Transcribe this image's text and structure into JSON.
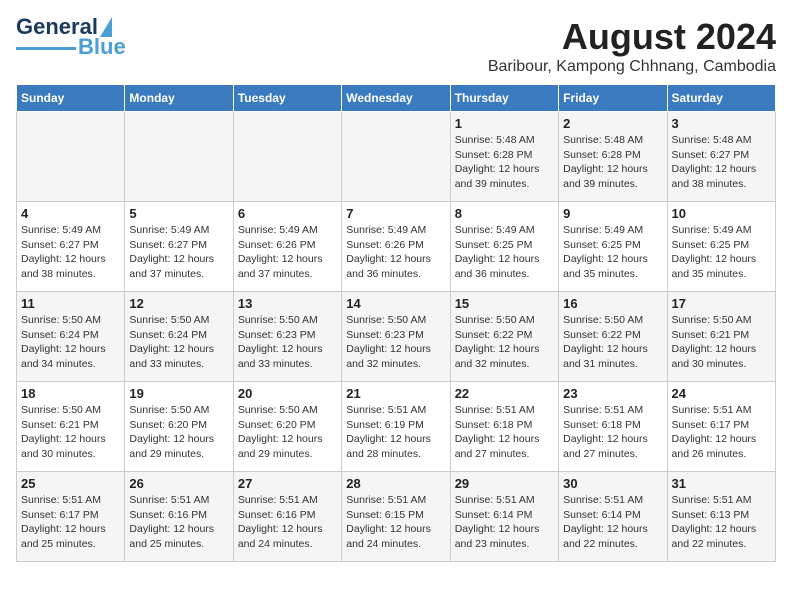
{
  "logo": {
    "text1": "General",
    "text2": "Blue"
  },
  "title": {
    "month_year": "August 2024",
    "location": "Baribour, Kampong Chhnang, Cambodia"
  },
  "headers": [
    "Sunday",
    "Monday",
    "Tuesday",
    "Wednesday",
    "Thursday",
    "Friday",
    "Saturday"
  ],
  "weeks": [
    [
      {
        "day": "",
        "info": ""
      },
      {
        "day": "",
        "info": ""
      },
      {
        "day": "",
        "info": ""
      },
      {
        "day": "",
        "info": ""
      },
      {
        "day": "1",
        "info": "Sunrise: 5:48 AM\nSunset: 6:28 PM\nDaylight: 12 hours\nand 39 minutes."
      },
      {
        "day": "2",
        "info": "Sunrise: 5:48 AM\nSunset: 6:28 PM\nDaylight: 12 hours\nand 39 minutes."
      },
      {
        "day": "3",
        "info": "Sunrise: 5:48 AM\nSunset: 6:27 PM\nDaylight: 12 hours\nand 38 minutes."
      }
    ],
    [
      {
        "day": "4",
        "info": "Sunrise: 5:49 AM\nSunset: 6:27 PM\nDaylight: 12 hours\nand 38 minutes."
      },
      {
        "day": "5",
        "info": "Sunrise: 5:49 AM\nSunset: 6:27 PM\nDaylight: 12 hours\nand 37 minutes."
      },
      {
        "day": "6",
        "info": "Sunrise: 5:49 AM\nSunset: 6:26 PM\nDaylight: 12 hours\nand 37 minutes."
      },
      {
        "day": "7",
        "info": "Sunrise: 5:49 AM\nSunset: 6:26 PM\nDaylight: 12 hours\nand 36 minutes."
      },
      {
        "day": "8",
        "info": "Sunrise: 5:49 AM\nSunset: 6:25 PM\nDaylight: 12 hours\nand 36 minutes."
      },
      {
        "day": "9",
        "info": "Sunrise: 5:49 AM\nSunset: 6:25 PM\nDaylight: 12 hours\nand 35 minutes."
      },
      {
        "day": "10",
        "info": "Sunrise: 5:49 AM\nSunset: 6:25 PM\nDaylight: 12 hours\nand 35 minutes."
      }
    ],
    [
      {
        "day": "11",
        "info": "Sunrise: 5:50 AM\nSunset: 6:24 PM\nDaylight: 12 hours\nand 34 minutes."
      },
      {
        "day": "12",
        "info": "Sunrise: 5:50 AM\nSunset: 6:24 PM\nDaylight: 12 hours\nand 33 minutes."
      },
      {
        "day": "13",
        "info": "Sunrise: 5:50 AM\nSunset: 6:23 PM\nDaylight: 12 hours\nand 33 minutes."
      },
      {
        "day": "14",
        "info": "Sunrise: 5:50 AM\nSunset: 6:23 PM\nDaylight: 12 hours\nand 32 minutes."
      },
      {
        "day": "15",
        "info": "Sunrise: 5:50 AM\nSunset: 6:22 PM\nDaylight: 12 hours\nand 32 minutes."
      },
      {
        "day": "16",
        "info": "Sunrise: 5:50 AM\nSunset: 6:22 PM\nDaylight: 12 hours\nand 31 minutes."
      },
      {
        "day": "17",
        "info": "Sunrise: 5:50 AM\nSunset: 6:21 PM\nDaylight: 12 hours\nand 30 minutes."
      }
    ],
    [
      {
        "day": "18",
        "info": "Sunrise: 5:50 AM\nSunset: 6:21 PM\nDaylight: 12 hours\nand 30 minutes."
      },
      {
        "day": "19",
        "info": "Sunrise: 5:50 AM\nSunset: 6:20 PM\nDaylight: 12 hours\nand 29 minutes."
      },
      {
        "day": "20",
        "info": "Sunrise: 5:50 AM\nSunset: 6:20 PM\nDaylight: 12 hours\nand 29 minutes."
      },
      {
        "day": "21",
        "info": "Sunrise: 5:51 AM\nSunset: 6:19 PM\nDaylight: 12 hours\nand 28 minutes."
      },
      {
        "day": "22",
        "info": "Sunrise: 5:51 AM\nSunset: 6:18 PM\nDaylight: 12 hours\nand 27 minutes."
      },
      {
        "day": "23",
        "info": "Sunrise: 5:51 AM\nSunset: 6:18 PM\nDaylight: 12 hours\nand 27 minutes."
      },
      {
        "day": "24",
        "info": "Sunrise: 5:51 AM\nSunset: 6:17 PM\nDaylight: 12 hours\nand 26 minutes."
      }
    ],
    [
      {
        "day": "25",
        "info": "Sunrise: 5:51 AM\nSunset: 6:17 PM\nDaylight: 12 hours\nand 25 minutes."
      },
      {
        "day": "26",
        "info": "Sunrise: 5:51 AM\nSunset: 6:16 PM\nDaylight: 12 hours\nand 25 minutes."
      },
      {
        "day": "27",
        "info": "Sunrise: 5:51 AM\nSunset: 6:16 PM\nDaylight: 12 hours\nand 24 minutes."
      },
      {
        "day": "28",
        "info": "Sunrise: 5:51 AM\nSunset: 6:15 PM\nDaylight: 12 hours\nand 24 minutes."
      },
      {
        "day": "29",
        "info": "Sunrise: 5:51 AM\nSunset: 6:14 PM\nDaylight: 12 hours\nand 23 minutes."
      },
      {
        "day": "30",
        "info": "Sunrise: 5:51 AM\nSunset: 6:14 PM\nDaylight: 12 hours\nand 22 minutes."
      },
      {
        "day": "31",
        "info": "Sunrise: 5:51 AM\nSunset: 6:13 PM\nDaylight: 12 hours\nand 22 minutes."
      }
    ]
  ]
}
